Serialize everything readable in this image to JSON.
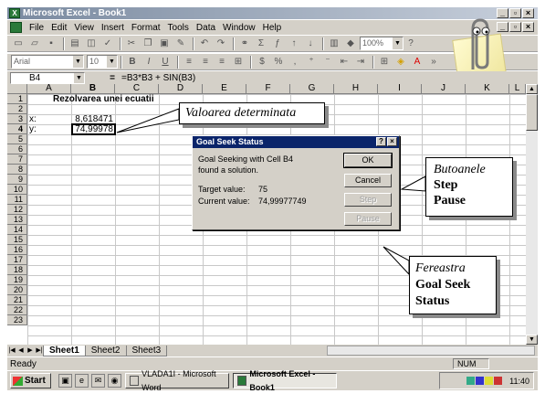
{
  "window": {
    "title": "Microsoft Excel - Book1",
    "min": "_",
    "max": "▫",
    "close": "×"
  },
  "menu": [
    "File",
    "Edit",
    "View",
    "Insert",
    "Format",
    "Tools",
    "Data",
    "Window",
    "Help"
  ],
  "toolbar": {
    "zoom": "100%",
    "font_name": "Arial",
    "font_size": "10",
    "bold": "B",
    "italic": "I",
    "underline": "U"
  },
  "formula_bar": {
    "name_box": "B4",
    "equals": "=",
    "formula": "=B3*B3 + SIN(B3)"
  },
  "columns": [
    "A",
    "B",
    "C",
    "D",
    "E",
    "F",
    "G",
    "H",
    "I",
    "J",
    "K",
    "L"
  ],
  "rows": [
    "1",
    "2",
    "3",
    "4",
    "5",
    "6",
    "7",
    "8",
    "9",
    "10",
    "11",
    "12",
    "13",
    "14",
    "15",
    "16",
    "17",
    "18",
    "19",
    "20",
    "21",
    "22",
    "23"
  ],
  "cells": {
    "title": "Rezolvarea unei ecuatii",
    "x_label": "x:",
    "x_value": "8,618471",
    "y_label": "y:",
    "y_value": "74,99978"
  },
  "sheet_tabs": [
    "Sheet1",
    "Sheet2",
    "Sheet3"
  ],
  "status": {
    "ready": "Ready",
    "num": "NUM"
  },
  "taskbar": {
    "start": "Start",
    "tasks": [
      "VLADA1I - Microsoft Word",
      "Microsoft Excel - Book1"
    ],
    "clock": "11:40"
  },
  "dialog": {
    "title": "Goal Seek Status",
    "help": "?",
    "close": "×",
    "line1": "Goal Seeking with Cell B4",
    "line2": "found a solution.",
    "target_label": "Target value:",
    "target_value": "75",
    "current_label": "Current value:",
    "current_value": "74,99977749",
    "ok": "OK",
    "cancel": "Cancel",
    "step": "Step",
    "pause": "Pause"
  },
  "callouts": {
    "valoarea": "Valoarea determinata",
    "butoanele": "Butoanele",
    "step": "Step",
    "pause": "Pause",
    "fereastra": "Fereastra",
    "goal_seek": "Goal Seek",
    "status": "Status"
  }
}
